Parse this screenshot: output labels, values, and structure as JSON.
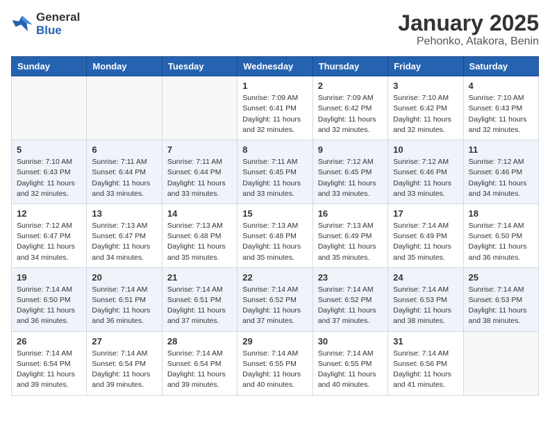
{
  "header": {
    "logo_general": "General",
    "logo_blue": "Blue",
    "title": "January 2025",
    "subtitle": "Pehonko, Atakora, Benin"
  },
  "days_of_week": [
    "Sunday",
    "Monday",
    "Tuesday",
    "Wednesday",
    "Thursday",
    "Friday",
    "Saturday"
  ],
  "weeks": [
    [
      {
        "day": "",
        "info": ""
      },
      {
        "day": "",
        "info": ""
      },
      {
        "day": "",
        "info": ""
      },
      {
        "day": "1",
        "sunrise": "7:09 AM",
        "sunset": "6:41 PM",
        "daylight": "11 hours and 32 minutes."
      },
      {
        "day": "2",
        "sunrise": "7:09 AM",
        "sunset": "6:42 PM",
        "daylight": "11 hours and 32 minutes."
      },
      {
        "day": "3",
        "sunrise": "7:10 AM",
        "sunset": "6:42 PM",
        "daylight": "11 hours and 32 minutes."
      },
      {
        "day": "4",
        "sunrise": "7:10 AM",
        "sunset": "6:43 PM",
        "daylight": "11 hours and 32 minutes."
      }
    ],
    [
      {
        "day": "5",
        "sunrise": "7:10 AM",
        "sunset": "6:43 PM",
        "daylight": "11 hours and 32 minutes."
      },
      {
        "day": "6",
        "sunrise": "7:11 AM",
        "sunset": "6:44 PM",
        "daylight": "11 hours and 33 minutes."
      },
      {
        "day": "7",
        "sunrise": "7:11 AM",
        "sunset": "6:44 PM",
        "daylight": "11 hours and 33 minutes."
      },
      {
        "day": "8",
        "sunrise": "7:11 AM",
        "sunset": "6:45 PM",
        "daylight": "11 hours and 33 minutes."
      },
      {
        "day": "9",
        "sunrise": "7:12 AM",
        "sunset": "6:45 PM",
        "daylight": "11 hours and 33 minutes."
      },
      {
        "day": "10",
        "sunrise": "7:12 AM",
        "sunset": "6:46 PM",
        "daylight": "11 hours and 33 minutes."
      },
      {
        "day": "11",
        "sunrise": "7:12 AM",
        "sunset": "6:46 PM",
        "daylight": "11 hours and 34 minutes."
      }
    ],
    [
      {
        "day": "12",
        "sunrise": "7:12 AM",
        "sunset": "6:47 PM",
        "daylight": "11 hours and 34 minutes."
      },
      {
        "day": "13",
        "sunrise": "7:13 AM",
        "sunset": "6:47 PM",
        "daylight": "11 hours and 34 minutes."
      },
      {
        "day": "14",
        "sunrise": "7:13 AM",
        "sunset": "6:48 PM",
        "daylight": "11 hours and 35 minutes."
      },
      {
        "day": "15",
        "sunrise": "7:13 AM",
        "sunset": "6:48 PM",
        "daylight": "11 hours and 35 minutes."
      },
      {
        "day": "16",
        "sunrise": "7:13 AM",
        "sunset": "6:49 PM",
        "daylight": "11 hours and 35 minutes."
      },
      {
        "day": "17",
        "sunrise": "7:14 AM",
        "sunset": "6:49 PM",
        "daylight": "11 hours and 35 minutes."
      },
      {
        "day": "18",
        "sunrise": "7:14 AM",
        "sunset": "6:50 PM",
        "daylight": "11 hours and 36 minutes."
      }
    ],
    [
      {
        "day": "19",
        "sunrise": "7:14 AM",
        "sunset": "6:50 PM",
        "daylight": "11 hours and 36 minutes."
      },
      {
        "day": "20",
        "sunrise": "7:14 AM",
        "sunset": "6:51 PM",
        "daylight": "11 hours and 36 minutes."
      },
      {
        "day": "21",
        "sunrise": "7:14 AM",
        "sunset": "6:51 PM",
        "daylight": "11 hours and 37 minutes."
      },
      {
        "day": "22",
        "sunrise": "7:14 AM",
        "sunset": "6:52 PM",
        "daylight": "11 hours and 37 minutes."
      },
      {
        "day": "23",
        "sunrise": "7:14 AM",
        "sunset": "6:52 PM",
        "daylight": "11 hours and 37 minutes."
      },
      {
        "day": "24",
        "sunrise": "7:14 AM",
        "sunset": "6:53 PM",
        "daylight": "11 hours and 38 minutes."
      },
      {
        "day": "25",
        "sunrise": "7:14 AM",
        "sunset": "6:53 PM",
        "daylight": "11 hours and 38 minutes."
      }
    ],
    [
      {
        "day": "26",
        "sunrise": "7:14 AM",
        "sunset": "6:54 PM",
        "daylight": "11 hours and 39 minutes."
      },
      {
        "day": "27",
        "sunrise": "7:14 AM",
        "sunset": "6:54 PM",
        "daylight": "11 hours and 39 minutes."
      },
      {
        "day": "28",
        "sunrise": "7:14 AM",
        "sunset": "6:54 PM",
        "daylight": "11 hours and 39 minutes."
      },
      {
        "day": "29",
        "sunrise": "7:14 AM",
        "sunset": "6:55 PM",
        "daylight": "11 hours and 40 minutes."
      },
      {
        "day": "30",
        "sunrise": "7:14 AM",
        "sunset": "6:55 PM",
        "daylight": "11 hours and 40 minutes."
      },
      {
        "day": "31",
        "sunrise": "7:14 AM",
        "sunset": "6:56 PM",
        "daylight": "11 hours and 41 minutes."
      },
      {
        "day": "",
        "info": ""
      }
    ]
  ]
}
